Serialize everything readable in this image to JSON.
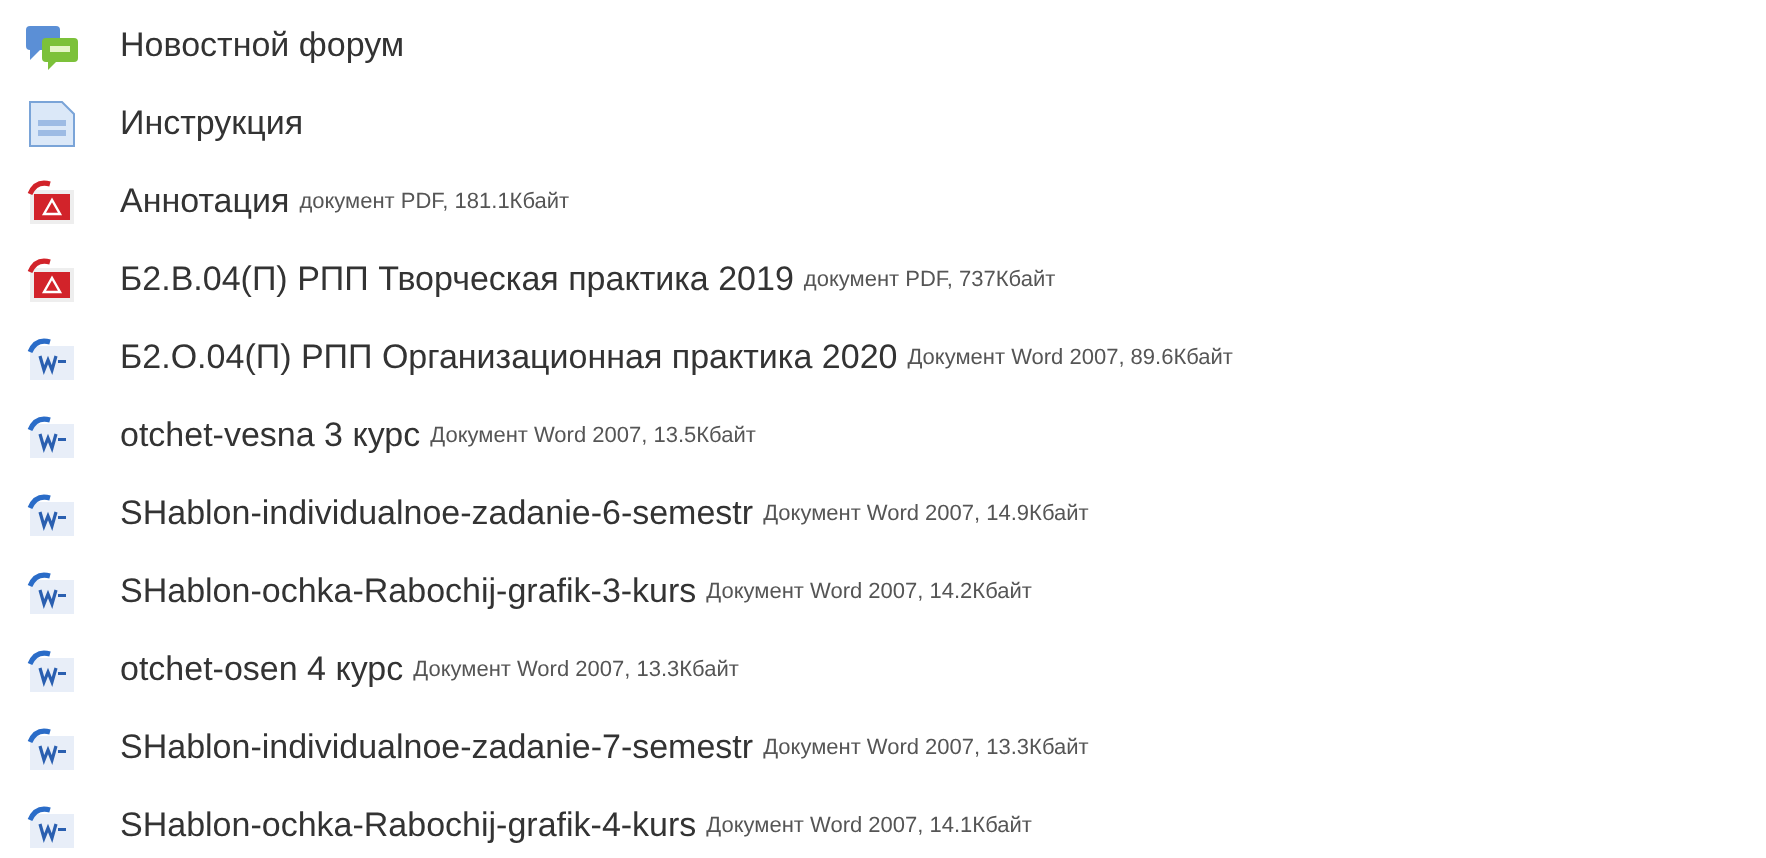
{
  "items": [
    {
      "kind": "forum",
      "title": "Новостной форум"
    },
    {
      "kind": "page",
      "title": "Инструкция"
    },
    {
      "kind": "pdf",
      "title": "Аннотация",
      "details": "документ PDF, 181.1Кбайт"
    },
    {
      "kind": "pdf",
      "title": "Б2.В.04(П) РПП Творческая практика 2019",
      "details": "документ PDF, 737Кбайт"
    },
    {
      "kind": "word",
      "title": "Б2.О.04(П) РПП Организационная практика 2020",
      "details": "Документ Word 2007, 89.6Кбайт"
    },
    {
      "kind": "word",
      "title": "otchet-vesna 3 курс",
      "details": "Документ Word 2007, 13.5Кбайт"
    },
    {
      "kind": "word",
      "title": "SHablon-individualnoe-zadanie-6-semestr",
      "details": "Документ Word 2007, 14.9Кбайт"
    },
    {
      "kind": "word",
      "title": "SHablon-ochka-Rabochij-grafik-3-kurs",
      "details": "Документ Word 2007, 14.2Кбайт"
    },
    {
      "kind": "word",
      "title": "otchet-osen 4 курс",
      "details": "Документ Word 2007, 13.3Кбайт"
    },
    {
      "kind": "word",
      "title": "SHablon-individualnoe-zadanie-7-semestr",
      "details": "Документ Word 2007, 13.3Кбайт"
    },
    {
      "kind": "word",
      "title": "SHablon-ochka-Rabochij-grafik-4-kurs",
      "details": "Документ Word 2007, 14.1Кбайт"
    }
  ]
}
